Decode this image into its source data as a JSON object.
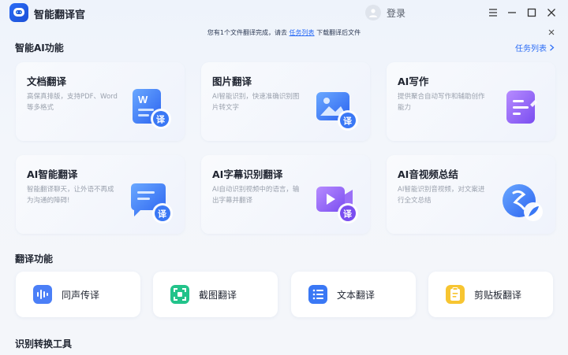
{
  "app": {
    "title": "智能翻译官",
    "login_label": "登录"
  },
  "notice": {
    "prefix": "您有1个文件翻译完成，请去",
    "link_text": "任务列表",
    "suffix": "下载翻译后文件"
  },
  "section_ai": {
    "title": "智能AI功能",
    "task_list_label": "任务列表"
  },
  "cards": [
    {
      "title": "文档翻译",
      "desc": "高保真排版，支持PDF、Word等多格式",
      "icon": "document-translate-icon"
    },
    {
      "title": "图片翻译",
      "desc": "AI智能识别，快速准确识别图片转文字",
      "icon": "image-translate-icon"
    },
    {
      "title": "AI写作",
      "desc": "提供聚合自动写作和辅助创作能力",
      "icon": "ai-writing-icon"
    },
    {
      "title": "AI智能翻译",
      "desc": "智能翻译聊天，让外语不再成为沟通的障碍!",
      "icon": "chat-translate-icon"
    },
    {
      "title": "AI字幕识别翻译",
      "desc": "AI自动识别视频中的语言，输出字幕并翻译",
      "icon": "video-subtitle-icon"
    },
    {
      "title": "AI音视频总结",
      "desc": "AI智能识别音视频，对文案进行全文总结",
      "icon": "av-summary-icon"
    }
  ],
  "badge": "译",
  "section_translate": {
    "title": "翻译功能"
  },
  "functions": [
    {
      "label": "同声传译",
      "icon": "voice-wave-icon"
    },
    {
      "label": "截图翻译",
      "icon": "screenshot-icon"
    },
    {
      "label": "文本翻译",
      "icon": "text-list-icon"
    },
    {
      "label": "剪贴板翻译",
      "icon": "clipboard-icon"
    }
  ],
  "section_tools": {
    "title": "识别转换工具"
  },
  "colors": {
    "accent": "#2b6cf6",
    "text": "#1f2430",
    "muted": "#9aa1ad"
  }
}
